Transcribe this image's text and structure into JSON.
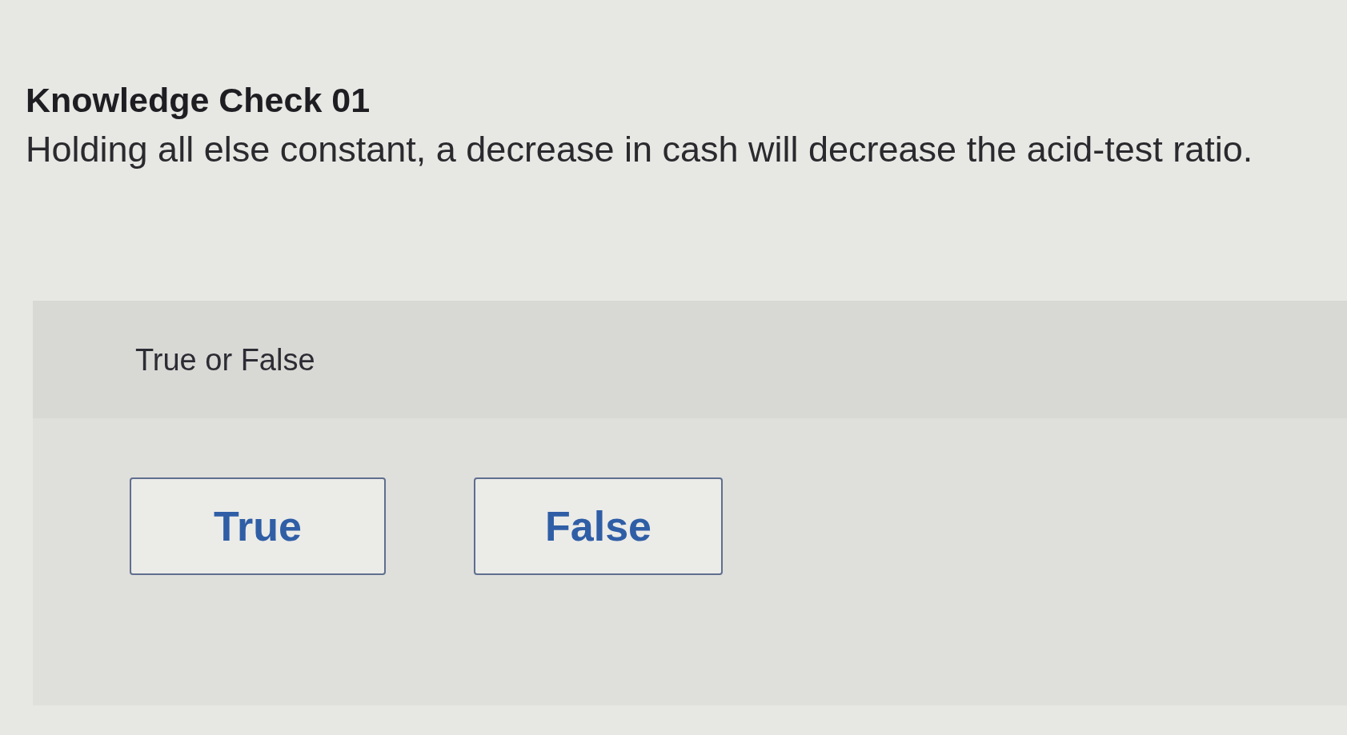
{
  "heading": "Knowledge Check 01",
  "question": "Holding all else constant, a decrease in cash will decrease the acid-test ratio.",
  "answer_panel": {
    "prompt": "True or False",
    "options": [
      {
        "label": "True",
        "selected": false
      },
      {
        "label": "False",
        "selected": false
      }
    ]
  }
}
